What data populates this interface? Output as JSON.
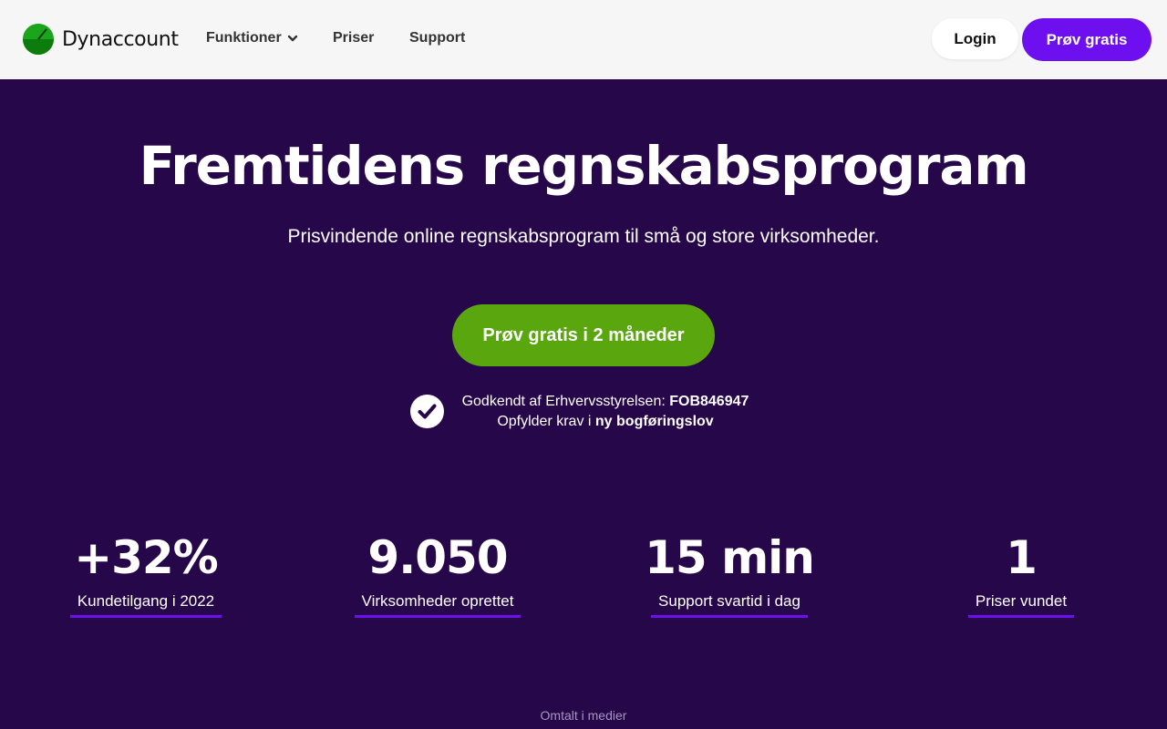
{
  "nav": {
    "brand": "Dynaccount",
    "links": [
      "Funktioner",
      "Priser",
      "Support"
    ],
    "login": "Login",
    "try_free": "Prøv gratis"
  },
  "hero": {
    "title": "Fremtidens regnskabsprogram",
    "subtitle": "Prisvindende online regnskabsprogram til små og store virksomheder.",
    "cta": "Prøv gratis i 2 måneder"
  },
  "approval": {
    "line1_text": "Godkendt af Erhvervsstyrelsen: ",
    "line1_bold": "FOB846947",
    "line2_text": "Opfylder krav i ",
    "line2_bold": "ny bogføringslov"
  },
  "stats": [
    {
      "value": "+32%",
      "label": "Kundetilgang i 2022"
    },
    {
      "value": "9.050",
      "label": "Virksomheder oprettet"
    },
    {
      "value": "15 min",
      "label": "Support svartid i dag"
    },
    {
      "value": "1",
      "label": "Priser vundet"
    }
  ],
  "media_label": "Omtalt i medier",
  "colors": {
    "background": "#25074a",
    "accent_purple": "#6e0ff0",
    "cta_green": "#5aa60f",
    "nav_bg": "#f6f6f6"
  }
}
